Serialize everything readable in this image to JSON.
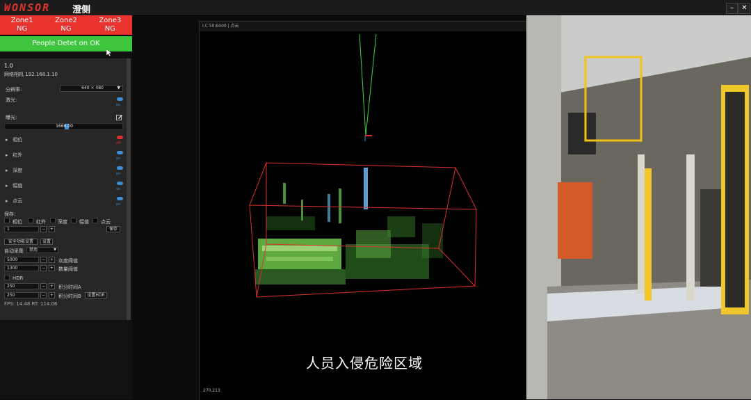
{
  "app": {
    "logo_text": "WONSOR",
    "logo_suffix": "澄侧",
    "min_label": "–",
    "close_label": "✕"
  },
  "zones": [
    {
      "name": "Zone1",
      "status": "NG"
    },
    {
      "name": "Zone2",
      "status": "NG"
    },
    {
      "name": "Zone3",
      "status": "NG"
    }
  ],
  "people": {
    "label": "People Detet on  OK"
  },
  "device": {
    "version": "1.0",
    "ip_label": "网络相机 192.168.1.10"
  },
  "resolution": {
    "label": "分辨率:",
    "value": "640 × 480"
  },
  "laser": {
    "label": "激光:",
    "state": "on"
  },
  "exposure": {
    "label": "曝光:",
    "value": "1666.00"
  },
  "layers": [
    {
      "label": "相位",
      "state": "off"
    },
    {
      "label": "红外",
      "state": "on"
    },
    {
      "label": "深度",
      "state": "on"
    },
    {
      "label": "幅值",
      "state": "on"
    },
    {
      "label": "点云",
      "state": "on"
    }
  ],
  "save": {
    "label": "保存:",
    "options": [
      "相位",
      "红外",
      "深度",
      "幅值",
      "点云"
    ],
    "count": "1",
    "button": "保存"
  },
  "safety": {
    "button": "安全功能设置",
    "set_button": "设置"
  },
  "auto_collect": {
    "label": "自动采集",
    "value": "禁用"
  },
  "thresholds": [
    {
      "value": "5000",
      "label": "灰度阈值"
    },
    {
      "value": "1300",
      "label": "数量阈值"
    }
  ],
  "hdr": {
    "label": "HDR",
    "rows": [
      {
        "value": "250",
        "label": "积分时间A"
      },
      {
        "value": "250",
        "label": "积分时间B"
      }
    ],
    "set_button": "设置HDR"
  },
  "fps": "FPS: 14.48  RT: 114.06",
  "viewer": {
    "header": "I.C 50:6000 | 点云",
    "coords": "270,213",
    "caption": "人员入侵危险区域"
  },
  "colors": {
    "ng": "#e8322e",
    "ok": "#3ec53e",
    "toggle_on": "#3a8fd6",
    "toggle_off": "#e02f2f",
    "box": "#e02f2f"
  }
}
